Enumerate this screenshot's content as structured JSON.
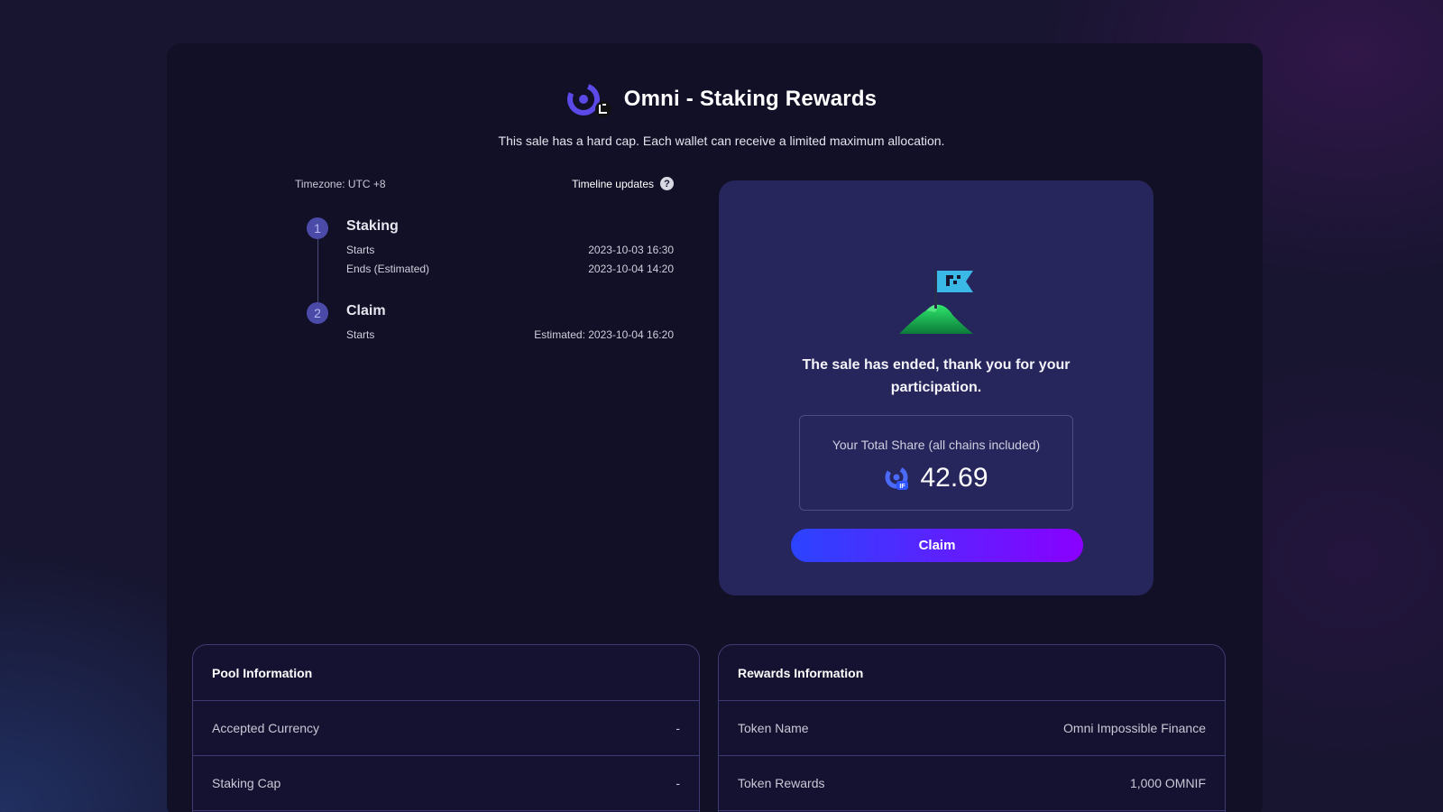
{
  "header": {
    "title": "Omni - Staking Rewards",
    "subtitle": "This sale has a hard cap. Each wallet can receive a limited maximum allocation.",
    "logo_icon": "impossible-finance-logo",
    "logo_badge_icon": "omni-badge"
  },
  "timeline": {
    "timezone": "Timezone: UTC +8",
    "updates_label": "Timeline updates",
    "steps": [
      {
        "number": "1",
        "title": "Staking",
        "rows": [
          {
            "label": "Starts",
            "value": "2023-10-03 16:30"
          },
          {
            "label": "Ends (Estimated)",
            "value": "2023-10-04 14:20"
          }
        ]
      },
      {
        "number": "2",
        "title": "Claim",
        "rows": [
          {
            "label": "Starts",
            "value": "Estimated: 2023-10-04 16:20"
          }
        ]
      }
    ]
  },
  "status_card": {
    "illustration_icon": "flag-on-mountain",
    "message": "The sale has ended, thank you for your participation.",
    "share_label": "Your Total Share (all chains included)",
    "share_value": "42.69",
    "token_icon": "if-token-icon",
    "claim_label": "Claim"
  },
  "pool_info": {
    "title": "Pool Information",
    "rows": [
      {
        "label": "Accepted Currency",
        "value": "-"
      },
      {
        "label": "Staking Cap",
        "value": "-"
      }
    ]
  },
  "rewards_info": {
    "title": "Rewards Information",
    "rows": [
      {
        "label": "Token Name",
        "value": "Omni Impossible Finance"
      },
      {
        "label": "Token Rewards",
        "value": "1,000 OMNIF"
      }
    ]
  },
  "colors": {
    "background": "#17152f",
    "card": "#26255c",
    "accent_start": "#2b44ff",
    "accent_end": "#8a00ff",
    "step_circle": "#4b4aa8"
  }
}
